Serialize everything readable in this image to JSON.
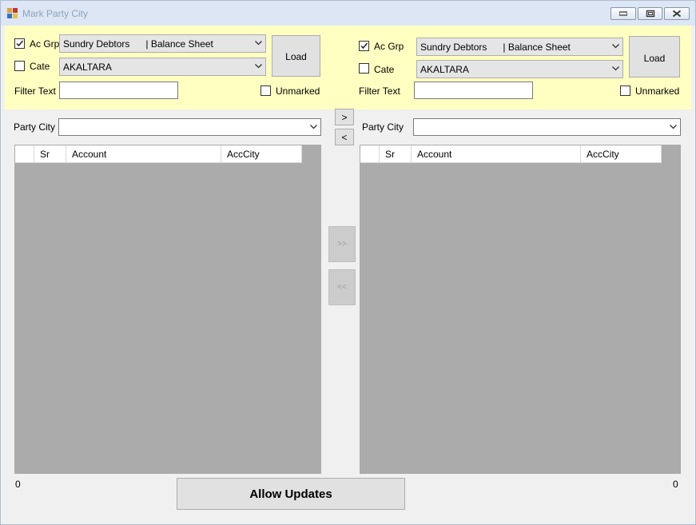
{
  "window": {
    "title": "Mark Party City",
    "controls": {
      "minimize": "minimize-icon",
      "restore": "restore-icon",
      "close": "close-icon"
    }
  },
  "colors": {
    "filter_band": "#ffffc2",
    "grid_background": "#ababab",
    "title_bar": "#dce6f4"
  },
  "left": {
    "acgrp": {
      "label": "Ac Grp",
      "checked": true,
      "value": "Sundry Debtors      | Balance Sheet"
    },
    "cate": {
      "label": "Cate",
      "checked": false,
      "value": "AKALTARA"
    },
    "load_label": "Load",
    "filter_label": "Filter Text",
    "filter_value": "",
    "unmarked": {
      "label": "Unmarked",
      "checked": false
    },
    "party_city_label": "Party City",
    "party_city_value": "",
    "columns": [
      "",
      "Sr",
      "Account",
      "AccCity"
    ],
    "count": "0"
  },
  "right": {
    "acgrp": {
      "label": "Ac Grp",
      "checked": true,
      "value": "Sundry Debtors      | Balance Sheet"
    },
    "cate": {
      "label": "Cate",
      "checked": false,
      "value": "AKALTARA"
    },
    "load_label": "Load",
    "filter_label": "Filter Text",
    "filter_value": "",
    "unmarked": {
      "label": "Unmarked",
      "checked": false
    },
    "party_city_label": "Party City",
    "party_city_value": "",
    "columns": [
      "",
      "Sr",
      "Account",
      "AccCity"
    ],
    "count": "0"
  },
  "middle": {
    "move_one_right": ">",
    "move_one_left": "<",
    "move_all_right": ">>",
    "move_all_left": "<<"
  },
  "footer": {
    "allow_updates_label": "Allow Updates"
  }
}
